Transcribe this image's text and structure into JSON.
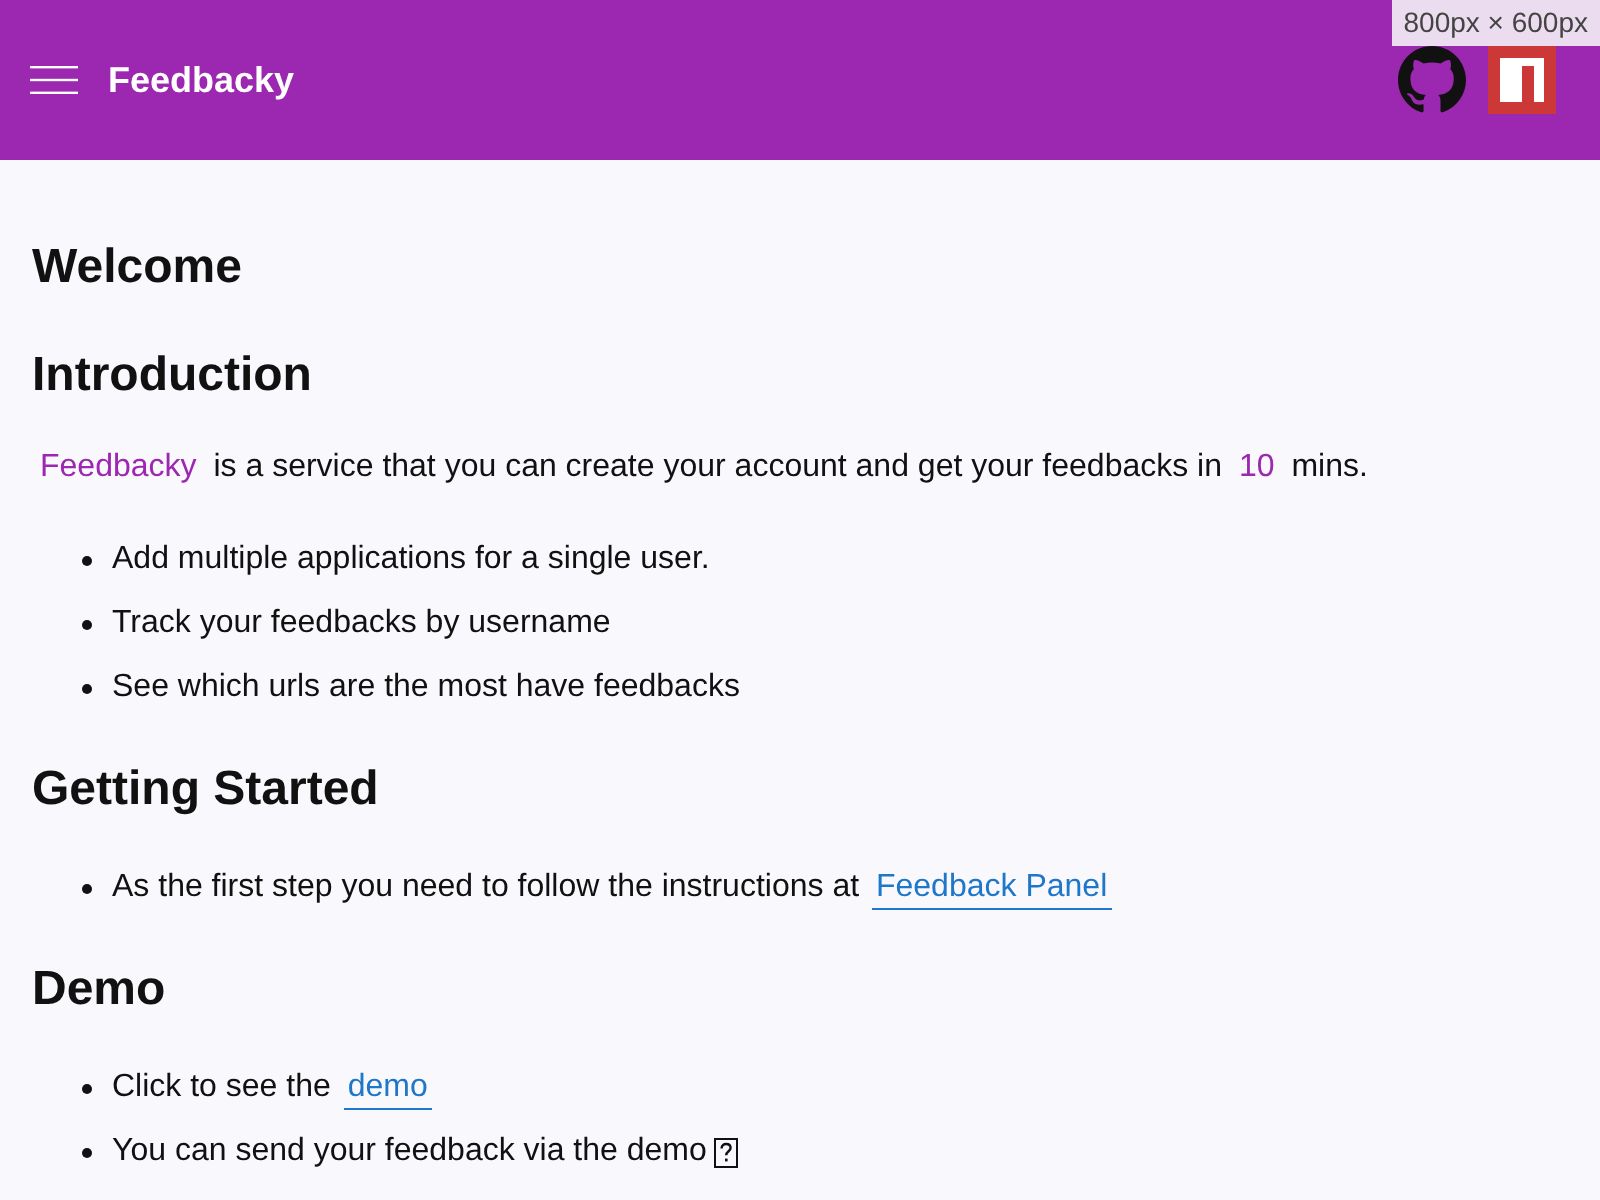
{
  "header": {
    "title": "Feedbacky"
  },
  "viewport_label": "800px × 600px",
  "sections": [
    {
      "heading": "Welcome"
    },
    {
      "heading": "Introduction",
      "paragraph": [
        {
          "kind": "highlight",
          "text": "Feedbacky"
        },
        {
          "kind": "plain",
          "text": "is a service that you can create your account and get your feedbacks in"
        },
        {
          "kind": "highlight",
          "text": "10"
        },
        {
          "kind": "plain",
          "text": "mins."
        }
      ],
      "items": [
        {
          "parts": [
            {
              "kind": "plain",
              "text": "Add multiple applications for a single user."
            }
          ]
        },
        {
          "parts": [
            {
              "kind": "plain",
              "text": "Track your feedbacks by username"
            }
          ]
        },
        {
          "parts": [
            {
              "kind": "plain",
              "text": "See which urls are the most have feedbacks"
            }
          ]
        }
      ]
    },
    {
      "heading": "Getting Started",
      "items": [
        {
          "parts": [
            {
              "kind": "plain",
              "text": "As the first step you need to follow the instructions at"
            },
            {
              "kind": "link",
              "text": "Feedback Panel"
            }
          ]
        }
      ]
    },
    {
      "heading": "Demo",
      "items": [
        {
          "parts": [
            {
              "kind": "plain",
              "text": "Click to see the"
            },
            {
              "kind": "link",
              "text": "demo"
            }
          ]
        },
        {
          "parts": [
            {
              "kind": "plain",
              "text": "You can send your feedback via the demo"
            },
            {
              "kind": "missing_glyph"
            }
          ]
        }
      ]
    }
  ]
}
